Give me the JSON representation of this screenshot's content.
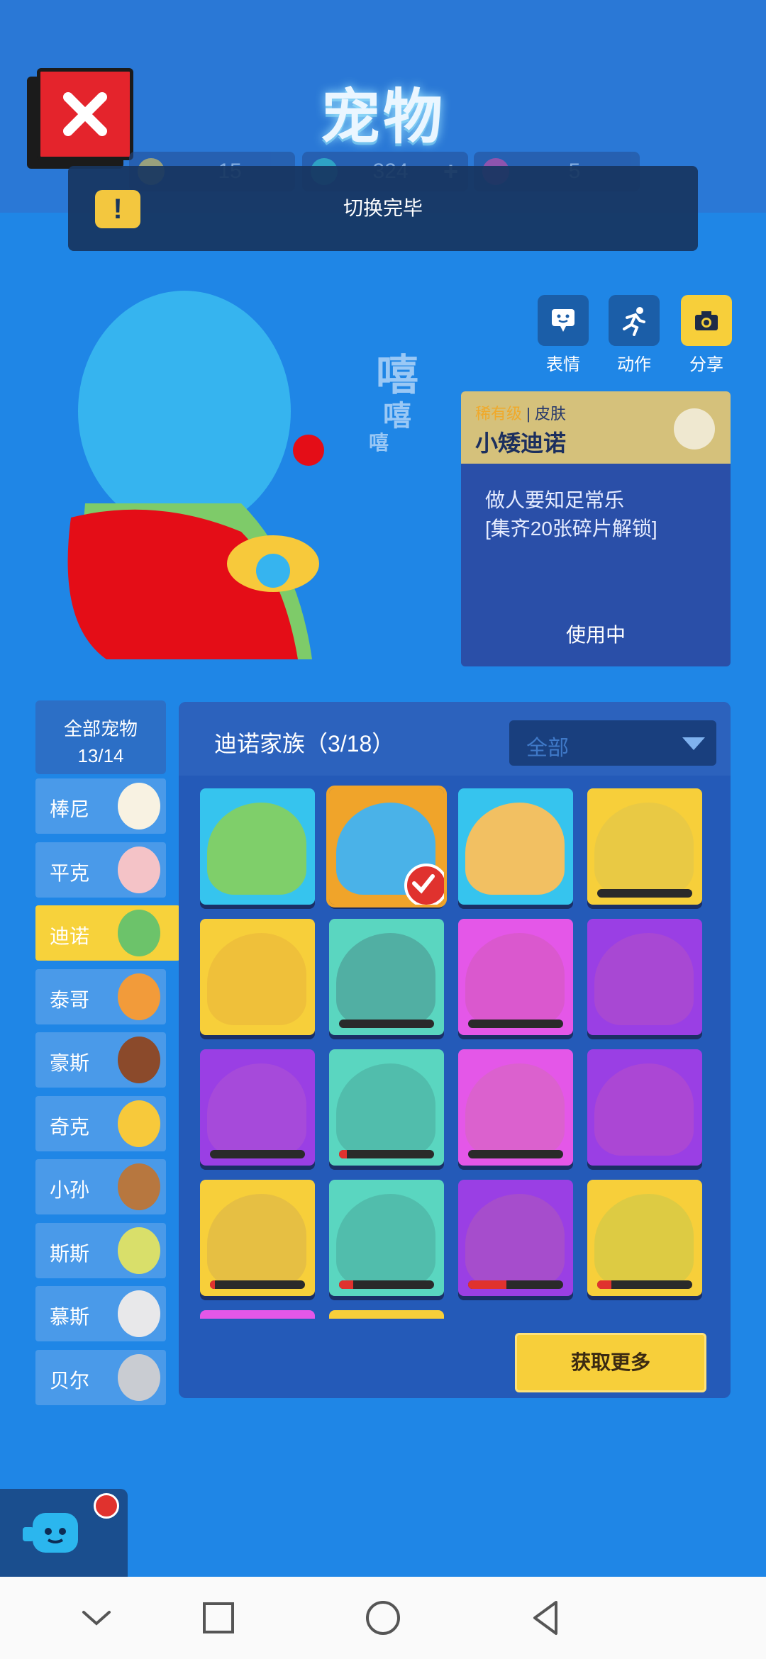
{
  "header": {
    "title": "宠物",
    "currencies": [
      {
        "name": "gold-coin",
        "value": "15",
        "color": "#f2c236"
      },
      {
        "name": "diamond",
        "value": "324",
        "color": "#33c6b8"
      },
      {
        "name": "ticket",
        "value": "5",
        "color": "#e0388f"
      }
    ]
  },
  "toast": {
    "message": "切换完毕"
  },
  "actions": [
    {
      "name": "emote",
      "label": "表情",
      "icon": "speech-bubble-icon"
    },
    {
      "name": "action",
      "label": "动作",
      "icon": "running-icon"
    },
    {
      "name": "share",
      "label": "分享",
      "icon": "camera-icon"
    }
  ],
  "info_card": {
    "rarity": "稀有级",
    "separator": "|",
    "type": "皮肤",
    "name": "小矮迪诺",
    "desc_line1": "做人要知足常乐",
    "desc_line2": "[集齐20张碎片解锁]",
    "status": "使用中"
  },
  "pet_list": {
    "all_label": "全部宠物",
    "all_count": "13/14",
    "items": [
      {
        "name": "棒尼",
        "color": "#f8f2e2"
      },
      {
        "name": "平克",
        "color": "#f4c3c7"
      },
      {
        "name": "迪诺",
        "color": "#6cc36a",
        "active": true
      },
      {
        "name": "泰哥",
        "color": "#f29b3a"
      },
      {
        "name": "豪斯",
        "color": "#8b4a2b"
      },
      {
        "name": "奇克",
        "color": "#f7c93b"
      },
      {
        "name": "小孙",
        "color": "#b7773f"
      },
      {
        "name": "斯斯",
        "color": "#d9df6a"
      },
      {
        "name": "慕斯",
        "color": "#e8e8ea"
      },
      {
        "name": "贝尔",
        "color": "#c9ccd2"
      }
    ]
  },
  "panel": {
    "family_title": "迪诺家族（3/18）",
    "filter": "全部",
    "get_more": "获取更多",
    "tiles": [
      {
        "bg": "#36c4ee",
        "dino": "#7fcf6a",
        "owned": true,
        "progress": 1
      },
      {
        "bg": "#f0a42a",
        "dino": "#4ab2e8",
        "owned": true,
        "selected": true,
        "progress": 1
      },
      {
        "bg": "#36c4ee",
        "dino": "#f2c062",
        "owned": true,
        "progress": 1
      },
      {
        "bg": "#f7cf3a",
        "dino": "#dfc44d",
        "owned": false,
        "progress": 0
      },
      {
        "bg": "#f7cf3a",
        "dino": "#e9b53a",
        "owned": false,
        "progress": -1
      },
      {
        "bg": "#5ad6c0",
        "dino": "#4a8f8a",
        "owned": false,
        "progress": 0
      },
      {
        "bg": "#e457e8",
        "dino": "#d15ab8",
        "owned": false,
        "progress": 0
      },
      {
        "bg": "#9a3fe4",
        "dino": "#b551c4",
        "owned": false,
        "progress": -1
      },
      {
        "bg": "#9a3fe4",
        "dino": "#b053d2",
        "owned": false,
        "progress": 0
      },
      {
        "bg": "#5ad6c0",
        "dino": "#4aa99a",
        "owned": false,
        "progress": 0.08
      },
      {
        "bg": "#e457e8",
        "dino": "#d46ab8",
        "owned": false,
        "progress": 0
      },
      {
        "bg": "#9a3fe4",
        "dino": "#b94fc6",
        "owned": false,
        "progress": -1
      },
      {
        "bg": "#f7cf3a",
        "dino": "#d9b24a",
        "owned": false,
        "progress": 0.05
      },
      {
        "bg": "#5ad6c0",
        "dino": "#4aa99a",
        "owned": false,
        "progress": 0.15
      },
      {
        "bg": "#9a3fe4",
        "dino": "#b05ab8",
        "owned": false,
        "progress": 0.4
      },
      {
        "bg": "#f7cf3a",
        "dino": "#c8c94a",
        "owned": false,
        "progress": 0.15
      }
    ]
  },
  "navbar": {
    "icons": [
      "chevron-down-icon",
      "recents-icon",
      "home-icon",
      "back-icon"
    ]
  }
}
